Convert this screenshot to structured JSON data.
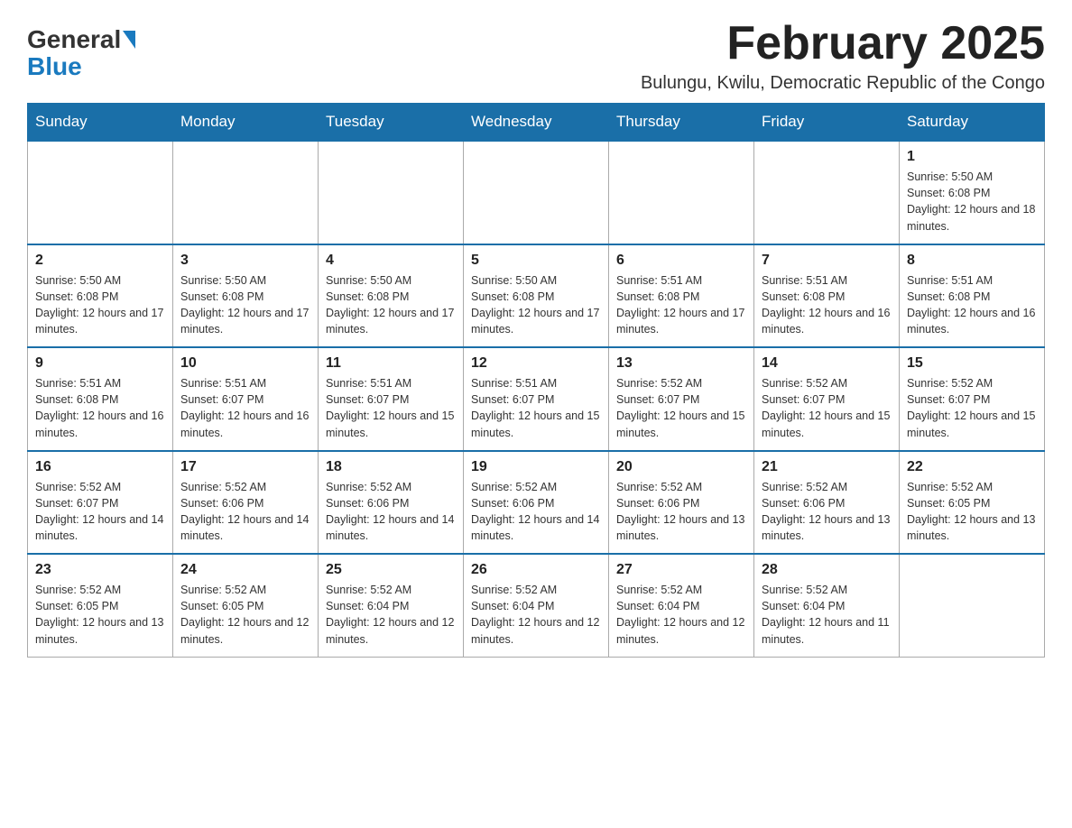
{
  "logo": {
    "text_general": "General",
    "text_blue": "Blue"
  },
  "title": {
    "month_year": "February 2025",
    "location": "Bulungu, Kwilu, Democratic Republic of the Congo"
  },
  "weekdays": [
    "Sunday",
    "Monday",
    "Tuesday",
    "Wednesday",
    "Thursday",
    "Friday",
    "Saturday"
  ],
  "weeks": [
    [
      {
        "day": "",
        "empty": true
      },
      {
        "day": "",
        "empty": true
      },
      {
        "day": "",
        "empty": true
      },
      {
        "day": "",
        "empty": true
      },
      {
        "day": "",
        "empty": true
      },
      {
        "day": "",
        "empty": true
      },
      {
        "day": "1",
        "sunrise": "5:50 AM",
        "sunset": "6:08 PM",
        "daylight": "12 hours and 18 minutes."
      }
    ],
    [
      {
        "day": "2",
        "sunrise": "5:50 AM",
        "sunset": "6:08 PM",
        "daylight": "12 hours and 17 minutes."
      },
      {
        "day": "3",
        "sunrise": "5:50 AM",
        "sunset": "6:08 PM",
        "daylight": "12 hours and 17 minutes."
      },
      {
        "day": "4",
        "sunrise": "5:50 AM",
        "sunset": "6:08 PM",
        "daylight": "12 hours and 17 minutes."
      },
      {
        "day": "5",
        "sunrise": "5:50 AM",
        "sunset": "6:08 PM",
        "daylight": "12 hours and 17 minutes."
      },
      {
        "day": "6",
        "sunrise": "5:51 AM",
        "sunset": "6:08 PM",
        "daylight": "12 hours and 17 minutes."
      },
      {
        "day": "7",
        "sunrise": "5:51 AM",
        "sunset": "6:08 PM",
        "daylight": "12 hours and 16 minutes."
      },
      {
        "day": "8",
        "sunrise": "5:51 AM",
        "sunset": "6:08 PM",
        "daylight": "12 hours and 16 minutes."
      }
    ],
    [
      {
        "day": "9",
        "sunrise": "5:51 AM",
        "sunset": "6:08 PM",
        "daylight": "12 hours and 16 minutes."
      },
      {
        "day": "10",
        "sunrise": "5:51 AM",
        "sunset": "6:07 PM",
        "daylight": "12 hours and 16 minutes."
      },
      {
        "day": "11",
        "sunrise": "5:51 AM",
        "sunset": "6:07 PM",
        "daylight": "12 hours and 15 minutes."
      },
      {
        "day": "12",
        "sunrise": "5:51 AM",
        "sunset": "6:07 PM",
        "daylight": "12 hours and 15 minutes."
      },
      {
        "day": "13",
        "sunrise": "5:52 AM",
        "sunset": "6:07 PM",
        "daylight": "12 hours and 15 minutes."
      },
      {
        "day": "14",
        "sunrise": "5:52 AM",
        "sunset": "6:07 PM",
        "daylight": "12 hours and 15 minutes."
      },
      {
        "day": "15",
        "sunrise": "5:52 AM",
        "sunset": "6:07 PM",
        "daylight": "12 hours and 15 minutes."
      }
    ],
    [
      {
        "day": "16",
        "sunrise": "5:52 AM",
        "sunset": "6:07 PM",
        "daylight": "12 hours and 14 minutes."
      },
      {
        "day": "17",
        "sunrise": "5:52 AM",
        "sunset": "6:06 PM",
        "daylight": "12 hours and 14 minutes."
      },
      {
        "day": "18",
        "sunrise": "5:52 AM",
        "sunset": "6:06 PM",
        "daylight": "12 hours and 14 minutes."
      },
      {
        "day": "19",
        "sunrise": "5:52 AM",
        "sunset": "6:06 PM",
        "daylight": "12 hours and 14 minutes."
      },
      {
        "day": "20",
        "sunrise": "5:52 AM",
        "sunset": "6:06 PM",
        "daylight": "12 hours and 13 minutes."
      },
      {
        "day": "21",
        "sunrise": "5:52 AM",
        "sunset": "6:06 PM",
        "daylight": "12 hours and 13 minutes."
      },
      {
        "day": "22",
        "sunrise": "5:52 AM",
        "sunset": "6:05 PM",
        "daylight": "12 hours and 13 minutes."
      }
    ],
    [
      {
        "day": "23",
        "sunrise": "5:52 AM",
        "sunset": "6:05 PM",
        "daylight": "12 hours and 13 minutes."
      },
      {
        "day": "24",
        "sunrise": "5:52 AM",
        "sunset": "6:05 PM",
        "daylight": "12 hours and 12 minutes."
      },
      {
        "day": "25",
        "sunrise": "5:52 AM",
        "sunset": "6:04 PM",
        "daylight": "12 hours and 12 minutes."
      },
      {
        "day": "26",
        "sunrise": "5:52 AM",
        "sunset": "6:04 PM",
        "daylight": "12 hours and 12 minutes."
      },
      {
        "day": "27",
        "sunrise": "5:52 AM",
        "sunset": "6:04 PM",
        "daylight": "12 hours and 12 minutes."
      },
      {
        "day": "28",
        "sunrise": "5:52 AM",
        "sunset": "6:04 PM",
        "daylight": "12 hours and 11 minutes."
      },
      {
        "day": "",
        "empty": true
      }
    ]
  ]
}
